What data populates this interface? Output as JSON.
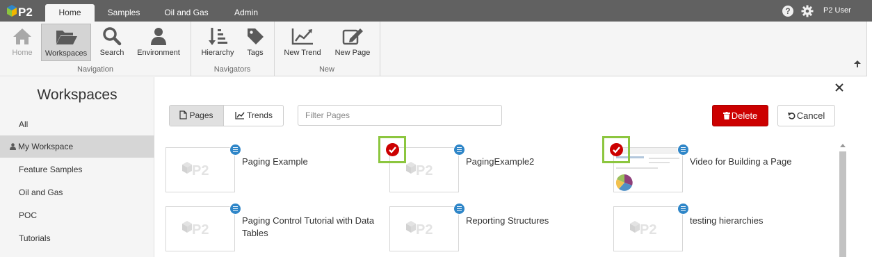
{
  "top_nav": {
    "logo_text": "P2",
    "tabs": [
      "Home",
      "Samples",
      "Oil and Gas",
      "Admin"
    ],
    "active_tab": "Home",
    "user_label": "P2 User"
  },
  "ribbon": {
    "home_label": "Home",
    "workspaces_label": "Workspaces",
    "search_label": "Search",
    "environment_label": "Environment",
    "navigation_group": "Navigation",
    "hierarchy_label": "Hierarchy",
    "tags_label": "Tags",
    "navigators_group": "Navigators",
    "new_trend_label": "New Trend",
    "new_page_label": "New Page",
    "new_group": "New"
  },
  "sidebar": {
    "title": "Workspaces",
    "items": [
      "All",
      "My Workspace",
      "Feature Samples",
      "Oil and Gas",
      "POC",
      "Tutorials"
    ],
    "selected": "My Workspace"
  },
  "toolbar": {
    "pages_label": "Pages",
    "trends_label": "Trends",
    "filter_placeholder": "Filter Pages",
    "delete_label": "Delete",
    "cancel_label": "Cancel"
  },
  "pages": [
    {
      "title": "Paging Example",
      "selected": false
    },
    {
      "title": "PagingExample2",
      "selected": true
    },
    {
      "title": "Video for Building a Page",
      "selected": true
    },
    {
      "title": "Paging Control Tutorial with Data Tables",
      "selected": false
    },
    {
      "title": "Reporting Structures",
      "selected": false
    },
    {
      "title": "testing hierarchies",
      "selected": false
    }
  ],
  "colors": {
    "topbar": "#616161",
    "ribbon": "#f5f5f5",
    "delete_red": "#cc0000",
    "selection_green": "#8cc63f",
    "menu_blue": "#2f86c8"
  }
}
